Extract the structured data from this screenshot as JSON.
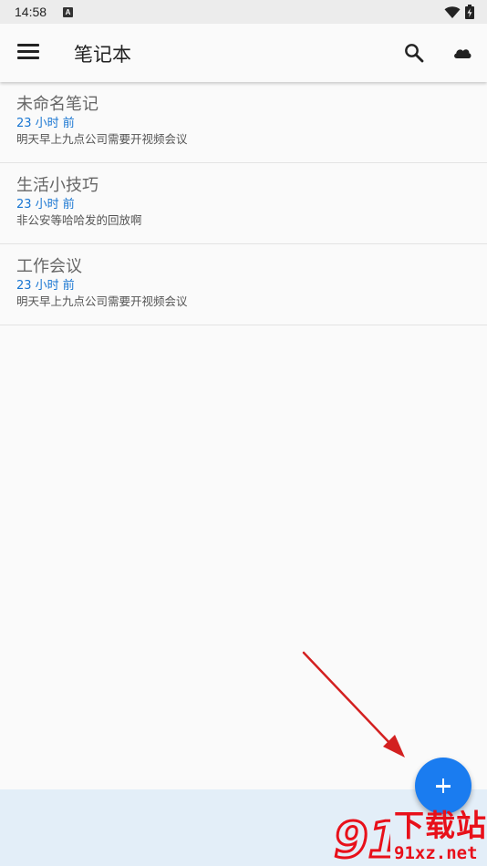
{
  "status_bar": {
    "time": "14:58",
    "notification_icon_letter": "A"
  },
  "toolbar": {
    "title": "笔记本"
  },
  "notes": [
    {
      "title": "未命名笔记",
      "time": "23 小时 前",
      "preview": "明天早上九点公司需要开视频会议"
    },
    {
      "title": "生活小技巧",
      "time": "23 小时 前",
      "preview": "非公安等哈哈发的回放啊"
    },
    {
      "title": "工作会议",
      "time": "23 小时 前",
      "preview": "明天早上九点公司需要开视频会议"
    }
  ],
  "watermark": {
    "brand_text": "下载站",
    "url_text": "91xz.net",
    "logo_text": "91"
  },
  "colors": {
    "accent": "#1a7cf0",
    "time_text": "#1976d2",
    "annotation_arrow": "#d32020",
    "watermark": "#e8101a"
  },
  "icons": {
    "menu": "hamburger-menu-icon",
    "search": "search-icon",
    "cloud": "cloud-icon",
    "wifi": "wifi-icon",
    "battery": "battery-charging-icon",
    "fab": "plus-icon"
  }
}
